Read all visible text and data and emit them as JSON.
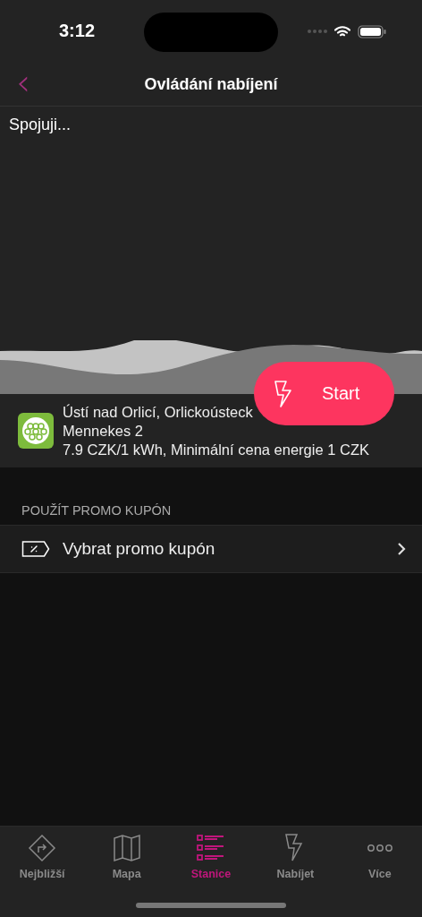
{
  "status_bar": {
    "time": "3:12"
  },
  "nav": {
    "back_icon": "‹",
    "title": "Ovládání nabíjení"
  },
  "status_text": "Spojuji...",
  "start_button": {
    "label": "Start"
  },
  "station": {
    "address": "Ústí nad Orlicí, Orlickoústeck",
    "connector": "Mennekes 2",
    "price": "7.9 CZK/1 kWh, Minimální cena energie 1 CZK"
  },
  "promo": {
    "header": "POUŽÍT PROMO KUPÓN",
    "row_label": "Vybrat promo kupón"
  },
  "tabs": [
    {
      "kind": "directions",
      "label": "Nejbližší",
      "selected": false
    },
    {
      "kind": "map",
      "label": "Mapa",
      "selected": false
    },
    {
      "kind": "list",
      "label": "Stanice",
      "selected": true
    },
    {
      "kind": "bolt",
      "label": "Nabíjet",
      "selected": false
    },
    {
      "kind": "more",
      "label": "Více",
      "selected": false
    }
  ]
}
